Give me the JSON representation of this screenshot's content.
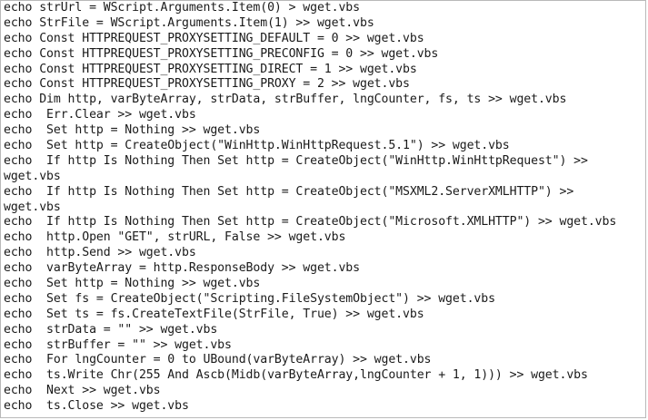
{
  "code": {
    "lines": [
      "echo strUrl = WScript.Arguments.Item(0) > wget.vbs",
      "echo StrFile = WScript.Arguments.Item(1) >> wget.vbs",
      "echo Const HTTPREQUEST_PROXYSETTING_DEFAULT = 0 >> wget.vbs",
      "echo Const HTTPREQUEST_PROXYSETTING_PRECONFIG = 0 >> wget.vbs",
      "echo Const HTTPREQUEST_PROXYSETTING_DIRECT = 1 >> wget.vbs",
      "echo Const HTTPREQUEST_PROXYSETTING_PROXY = 2 >> wget.vbs",
      "echo Dim http, varByteArray, strData, strBuffer, lngCounter, fs, ts >> wget.vbs",
      "echo  Err.Clear >> wget.vbs",
      "echo  Set http = Nothing >> wget.vbs",
      "echo  Set http = CreateObject(\"WinHttp.WinHttpRequest.5.1\") >> wget.vbs",
      "echo  If http Is Nothing Then Set http = CreateObject(\"WinHttp.WinHttpRequest\") >>",
      "wget.vbs",
      "echo  If http Is Nothing Then Set http = CreateObject(\"MSXML2.ServerXMLHTTP\") >>",
      "wget.vbs",
      "echo  If http Is Nothing Then Set http = CreateObject(\"Microsoft.XMLHTTP\") >> wget.vbs",
      "echo  http.Open \"GET\", strURL, False >> wget.vbs",
      "echo  http.Send >> wget.vbs",
      "echo  varByteArray = http.ResponseBody >> wget.vbs",
      "echo  Set http = Nothing >> wget.vbs",
      "echo  Set fs = CreateObject(\"Scripting.FileSystemObject\") >> wget.vbs",
      "echo  Set ts = fs.CreateTextFile(StrFile, True) >> wget.vbs",
      "echo  strData = \"\" >> wget.vbs",
      "echo  strBuffer = \"\" >> wget.vbs",
      "echo  For lngCounter = 0 to UBound(varByteArray) >> wget.vbs",
      "echo  ts.Write Chr(255 And Ascb(Midb(varByteArray,lngCounter + 1, 1))) >> wget.vbs",
      "echo  Next >> wget.vbs",
      "echo  ts.Close >> wget.vbs"
    ]
  }
}
